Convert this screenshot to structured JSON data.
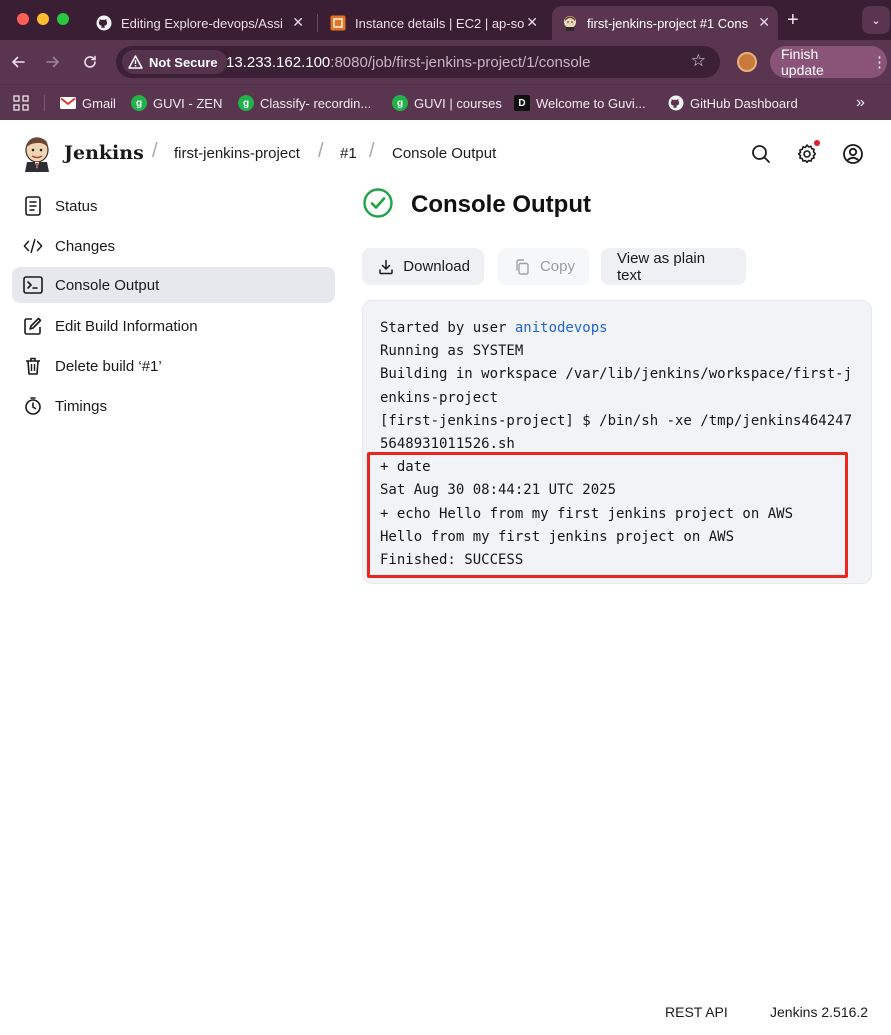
{
  "browser": {
    "tabs": [
      {
        "title": "Editing Explore-devops/Assi",
        "close": "✕",
        "icon": "github-icon"
      },
      {
        "title": "Instance details | EC2 | ap-so",
        "close": "✕",
        "icon": "aws-ec2-icon"
      },
      {
        "title": "first-jenkins-project #1 Cons",
        "close": "✕",
        "icon": "jenkins-icon",
        "active": true
      }
    ],
    "new_tab": "+",
    "tab_menu": "⌄",
    "not_secure_label": "Not Secure",
    "url_host": "13.233.162.100",
    "url_path": ":8080/job/first-jenkins-project/1/console",
    "finish_update": "Finish update",
    "bookmarks": [
      {
        "label": "Gmail",
        "icon": "gmail-icon"
      },
      {
        "label": "GUVI - ZEN",
        "icon": "guvi-icon"
      },
      {
        "label": "Classify- recordin...",
        "icon": "guvi-icon"
      },
      {
        "label": "GUVI | courses",
        "icon": "guvi-icon"
      },
      {
        "label": "Welcome to Guvi...",
        "icon": "d-icon"
      },
      {
        "label": "GitHub Dashboard",
        "icon": "github-icon"
      }
    ],
    "bookmarks_overflow": "»"
  },
  "jenkins": {
    "brand": "Jenkins",
    "breadcrumbs": [
      "first-jenkins-project",
      "#1",
      "Console Output"
    ],
    "breadcrumb_separator": "/",
    "side_panel": [
      {
        "label": "Status",
        "icon": "document-icon"
      },
      {
        "label": "Changes",
        "icon": "code-icon"
      },
      {
        "label": "Console Output",
        "icon": "terminal-icon",
        "active": true
      },
      {
        "label": "Edit Build Information",
        "icon": "edit-icon"
      },
      {
        "label": "Delete build ‘#1’",
        "icon": "trash-icon"
      },
      {
        "label": "Timings",
        "icon": "stopwatch-icon"
      }
    ],
    "page_title": "Console Output",
    "status": "success",
    "buttons": {
      "download": "Download",
      "copy": "Copy",
      "plain_text": "View as plain text"
    },
    "console": {
      "started_prefix": "Started by user ",
      "started_user": "anitodevops",
      "lines": [
        "Running as SYSTEM",
        "Building in workspace /var/lib/jenkins/workspace/first-jenkins-project",
        "[first-jenkins-project] $ /bin/sh -xe /tmp/jenkins4642475648931011526.sh",
        "+ date",
        "Sat Aug 30 08:44:21 UTC 2025",
        "+ echo Hello from my first jenkins project on AWS",
        "Hello from my first jenkins project on AWS",
        "Finished: SUCCESS"
      ]
    },
    "footer": {
      "rest_api": "REST API",
      "version": "Jenkins 2.516.2"
    }
  },
  "colors": {
    "chrome_dark": "#3a1f34",
    "chrome_toolbar": "#5a3550",
    "success_green": "#1ea446",
    "link_blue": "#1e65d6",
    "highlight_red": "#e8281f"
  }
}
